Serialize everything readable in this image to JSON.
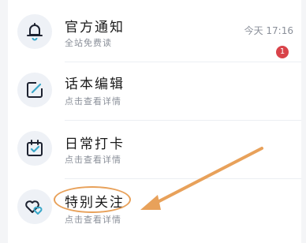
{
  "items": [
    {
      "title": "官方通知",
      "subtitle": "全站免费读",
      "icon": "bell-icon",
      "time": "今天 17:16",
      "badge": "1"
    },
    {
      "title": "话本编辑",
      "subtitle": "点击查看详情",
      "icon": "edit-icon"
    },
    {
      "title": "日常打卡",
      "subtitle": "点击查看详情",
      "icon": "calendar-check-icon"
    },
    {
      "title": "特别关注",
      "subtitle": "点击查看详情",
      "icon": "hearts-icon"
    }
  ],
  "colors": {
    "icon": "#1d2230",
    "accent": "#3aa7c8",
    "badge": "#d9434a",
    "annotation": "#e8a15a"
  }
}
